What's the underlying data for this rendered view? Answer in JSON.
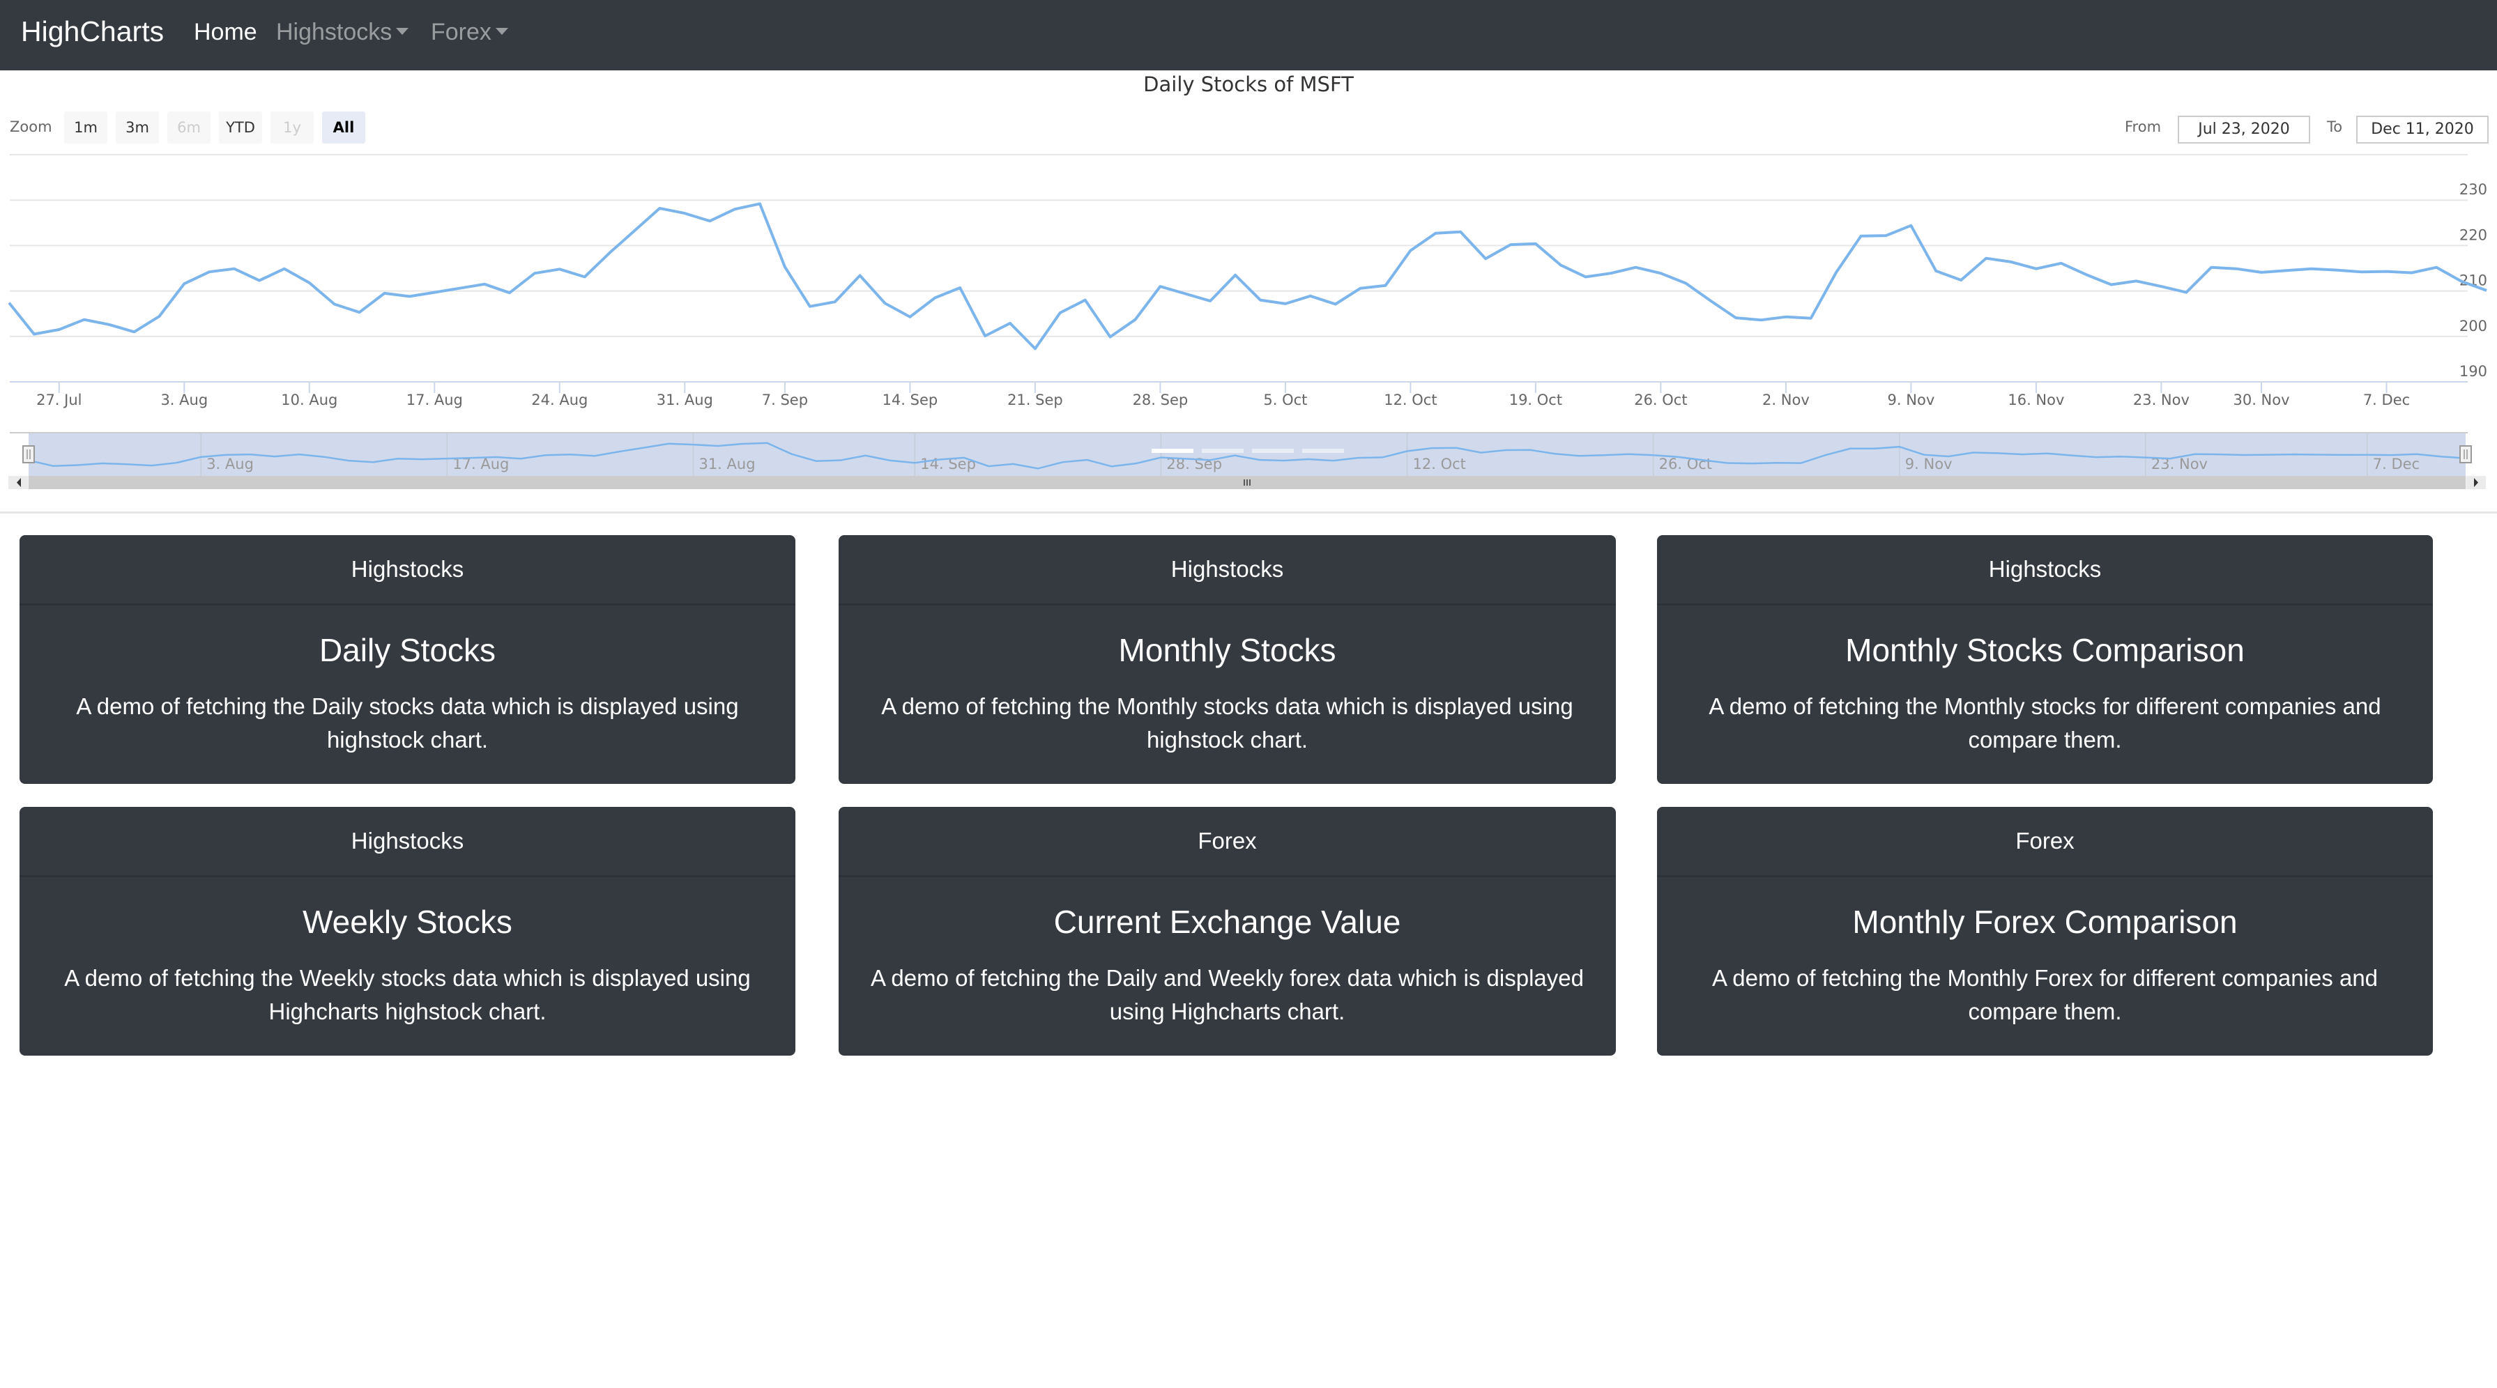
{
  "navbar": {
    "brand": "HighCharts",
    "links": [
      {
        "label": "Home",
        "active": true,
        "dropdown": false
      },
      {
        "label": "Highstocks",
        "active": false,
        "dropdown": true
      },
      {
        "label": "Forex",
        "active": false,
        "dropdown": true
      }
    ]
  },
  "range_selector": {
    "zoom_label": "Zoom",
    "buttons": [
      {
        "label": "1m",
        "state": "normal"
      },
      {
        "label": "3m",
        "state": "normal"
      },
      {
        "label": "6m",
        "state": "disabled"
      },
      {
        "label": "YTD",
        "state": "normal"
      },
      {
        "label": "1y",
        "state": "disabled"
      },
      {
        "label": "All",
        "state": "selected"
      }
    ],
    "from_label": "From",
    "from_value": "Jul 23, 2020",
    "to_label": "To",
    "to_value": "Dec 11, 2020"
  },
  "colors": {
    "navbar_bg": "#343a40",
    "series_line": "#7cb5ec",
    "navigator_mask": "#ccd6eb",
    "card_bg": "#343a40"
  },
  "chart_data": {
    "type": "line",
    "title": "Daily Stocks of MSFT",
    "xlabel": "",
    "ylabel": "",
    "ylim": [
      190,
      240
    ],
    "y_ticks": [
      190,
      200,
      210,
      220,
      230
    ],
    "grid": true,
    "legend": "none",
    "x_tick_labels": [
      "27. Jul",
      "3. Aug",
      "10. Aug",
      "17. Aug",
      "24. Aug",
      "31. Aug",
      "7. Sep",
      "14. Sep",
      "21. Sep",
      "28. Sep",
      "5. Oct",
      "12. Oct",
      "19. Oct",
      "26. Oct",
      "2. Nov",
      "9. Nov",
      "16. Nov",
      "23. Nov",
      "30. Nov",
      "7. Dec"
    ],
    "navigator_tick_labels": [
      "3. Aug",
      "17. Aug",
      "31. Aug",
      "14. Sep",
      "28. Sep",
      "12. Oct",
      "26. Oct",
      "9. Nov",
      "23. Nov",
      "7. Dec"
    ],
    "series": [
      {
        "name": "MSFT",
        "x": [
          "2020-07-23",
          "2020-07-24",
          "2020-07-27",
          "2020-07-28",
          "2020-07-29",
          "2020-07-30",
          "2020-07-31",
          "2020-08-03",
          "2020-08-04",
          "2020-08-05",
          "2020-08-06",
          "2020-08-07",
          "2020-08-10",
          "2020-08-11",
          "2020-08-12",
          "2020-08-13",
          "2020-08-14",
          "2020-08-17",
          "2020-08-18",
          "2020-08-19",
          "2020-08-20",
          "2020-08-21",
          "2020-08-24",
          "2020-08-25",
          "2020-08-26",
          "2020-08-27",
          "2020-08-28",
          "2020-08-31",
          "2020-09-01",
          "2020-09-02",
          "2020-09-03",
          "2020-09-04",
          "2020-09-08",
          "2020-09-09",
          "2020-09-10",
          "2020-09-11",
          "2020-09-14",
          "2020-09-15",
          "2020-09-16",
          "2020-09-17",
          "2020-09-18",
          "2020-09-21",
          "2020-09-22",
          "2020-09-23",
          "2020-09-24",
          "2020-09-25",
          "2020-09-28",
          "2020-09-29",
          "2020-09-30",
          "2020-10-01",
          "2020-10-02",
          "2020-10-05",
          "2020-10-06",
          "2020-10-07",
          "2020-10-08",
          "2020-10-09",
          "2020-10-12",
          "2020-10-13",
          "2020-10-14",
          "2020-10-15",
          "2020-10-16",
          "2020-10-19",
          "2020-10-20",
          "2020-10-21",
          "2020-10-22",
          "2020-10-23",
          "2020-10-26",
          "2020-10-27",
          "2020-10-28",
          "2020-10-29",
          "2020-10-30",
          "2020-11-02",
          "2020-11-03",
          "2020-11-04",
          "2020-11-05",
          "2020-11-06",
          "2020-11-09",
          "2020-11-10",
          "2020-11-11",
          "2020-11-12",
          "2020-11-13",
          "2020-11-16",
          "2020-11-17",
          "2020-11-18",
          "2020-11-19",
          "2020-11-20",
          "2020-11-23",
          "2020-11-24",
          "2020-11-25",
          "2020-11-27",
          "2020-11-30",
          "2020-12-01",
          "2020-12-02",
          "2020-12-03",
          "2020-12-04",
          "2020-12-07",
          "2020-12-08",
          "2020-12-09",
          "2020-12-10",
          "2020-12-11"
        ],
        "values": [
          207.4,
          200.5,
          201.5,
          203.7,
          202.6,
          201.0,
          204.4,
          211.6,
          214.2,
          214.9,
          212.3,
          214.9,
          211.8,
          207.1,
          205.3,
          209.5,
          208.8,
          209.7,
          210.6,
          211.5,
          209.6,
          213.9,
          214.8,
          213.1,
          218.4,
          223.3,
          228.2,
          227.1,
          225.4,
          228.0,
          229.2,
          215.3,
          206.6,
          207.6,
          213.4,
          207.3,
          204.3,
          208.5,
          210.7,
          200.1,
          202.9,
          197.3,
          205.2,
          208.0,
          199.9,
          203.7,
          211.0,
          209.4,
          207.8,
          213.5,
          208.0,
          207.2,
          208.9,
          207.1,
          210.6,
          211.2,
          218.9,
          222.7,
          223.0,
          217.1,
          220.2,
          220.4,
          215.7,
          213.1,
          213.9,
          215.2,
          213.9,
          211.7,
          207.8,
          204.1,
          203.6,
          204.3,
          204.0,
          214.0,
          222.1,
          222.2,
          224.4,
          214.4,
          212.4,
          217.2,
          216.4,
          214.9,
          216.1,
          213.6,
          211.4,
          212.2,
          211.0,
          209.7,
          215.2,
          214.9,
          214.1,
          214.5,
          214.9,
          214.6,
          214.2,
          214.3,
          214.0,
          215.2,
          212.1,
          210.1
        ]
      }
    ]
  },
  "cards": [
    {
      "header": "Highstocks",
      "title": "Daily Stocks",
      "text": "A demo of fetching the Daily stocks data which is displayed using highstock chart."
    },
    {
      "header": "Highstocks",
      "title": "Monthly Stocks",
      "text": "A demo of fetching the Monthly stocks data which is displayed using highstock chart."
    },
    {
      "header": "Highstocks",
      "title": "Monthly Stocks Comparison",
      "text": "A demo of fetching the Monthly stocks for different companies and compare them."
    },
    {
      "header": "Highstocks",
      "title": "Weekly Stocks",
      "text": "A demo of fetching the Weekly stocks data which is displayed using Highcharts highstock chart."
    },
    {
      "header": "Forex",
      "title": "Current Exchange Value",
      "text": "A demo of fetching the Daily and Weekly forex data which is displayed using Highcharts chart."
    },
    {
      "header": "Forex",
      "title": "Monthly Forex Comparison",
      "text": "A demo of fetching the Monthly Forex for different companies and compare them."
    }
  ]
}
